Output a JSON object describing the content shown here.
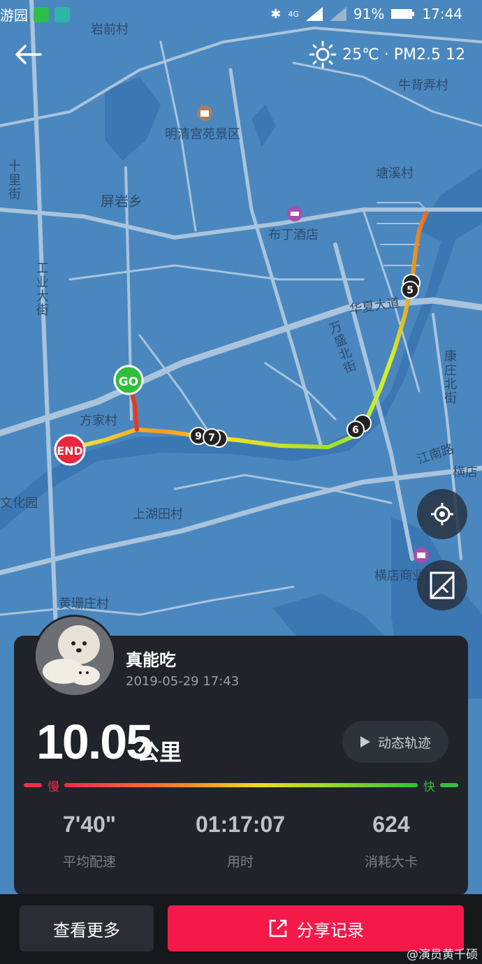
{
  "status_bar": {
    "left_text": "游园",
    "battery": "91%",
    "time": "17:44",
    "network": "4G"
  },
  "weather": {
    "text": "25℃ · PM2.5 12"
  },
  "map": {
    "labels": {
      "yanqiancun": "岩前村",
      "niubeinongcun": "牛背弄村",
      "mingqing": "明清宫苑景区",
      "tangxicun": "塘溪村",
      "shiligai": "十里街",
      "pingyanxiang": "屏岩乡",
      "budingjiudian": "布丁酒店",
      "gongyedajie": "工业大街",
      "huaxiadadao": "华夏大道",
      "wanshengbeijie": "万盛北街",
      "kangzhuangbeijie": "康庄北街",
      "fangjiacun": "方家村",
      "jiangnanlu": "江南路",
      "hengdian": "横店",
      "wenhuayuan": "文化园",
      "shanghutiancun": "上湖田村",
      "hengdianshangye": "横店商业步行街",
      "huangshanzhuangcun": "黄珊庄村"
    },
    "markers": {
      "start": "GO",
      "end": "END",
      "km5": "5",
      "km6": "6",
      "km7": "7",
      "km9": "9"
    }
  },
  "user": {
    "name": "真能吃",
    "datetime": "2019-05-29 17:43"
  },
  "run": {
    "distance": "10.05",
    "unit": "公里",
    "replay_label": "动态轨迹"
  },
  "speed_legend": {
    "slow": "慢",
    "fast": "快"
  },
  "stats": [
    {
      "value": "7'40\"",
      "label": "平均配速"
    },
    {
      "value": "01:17:07",
      "label": "用时"
    },
    {
      "value": "624",
      "label": "消耗大卡"
    }
  ],
  "actions": {
    "more": "查看更多",
    "share": "分享记录"
  },
  "watermark": "@演员黄千硕",
  "colors": {
    "map_bg": "#4a87bf",
    "road": "#a7c3db",
    "card": "#202329",
    "accent": "#f5194a",
    "go": "#2fbf3a",
    "end": "#e8263e"
  }
}
